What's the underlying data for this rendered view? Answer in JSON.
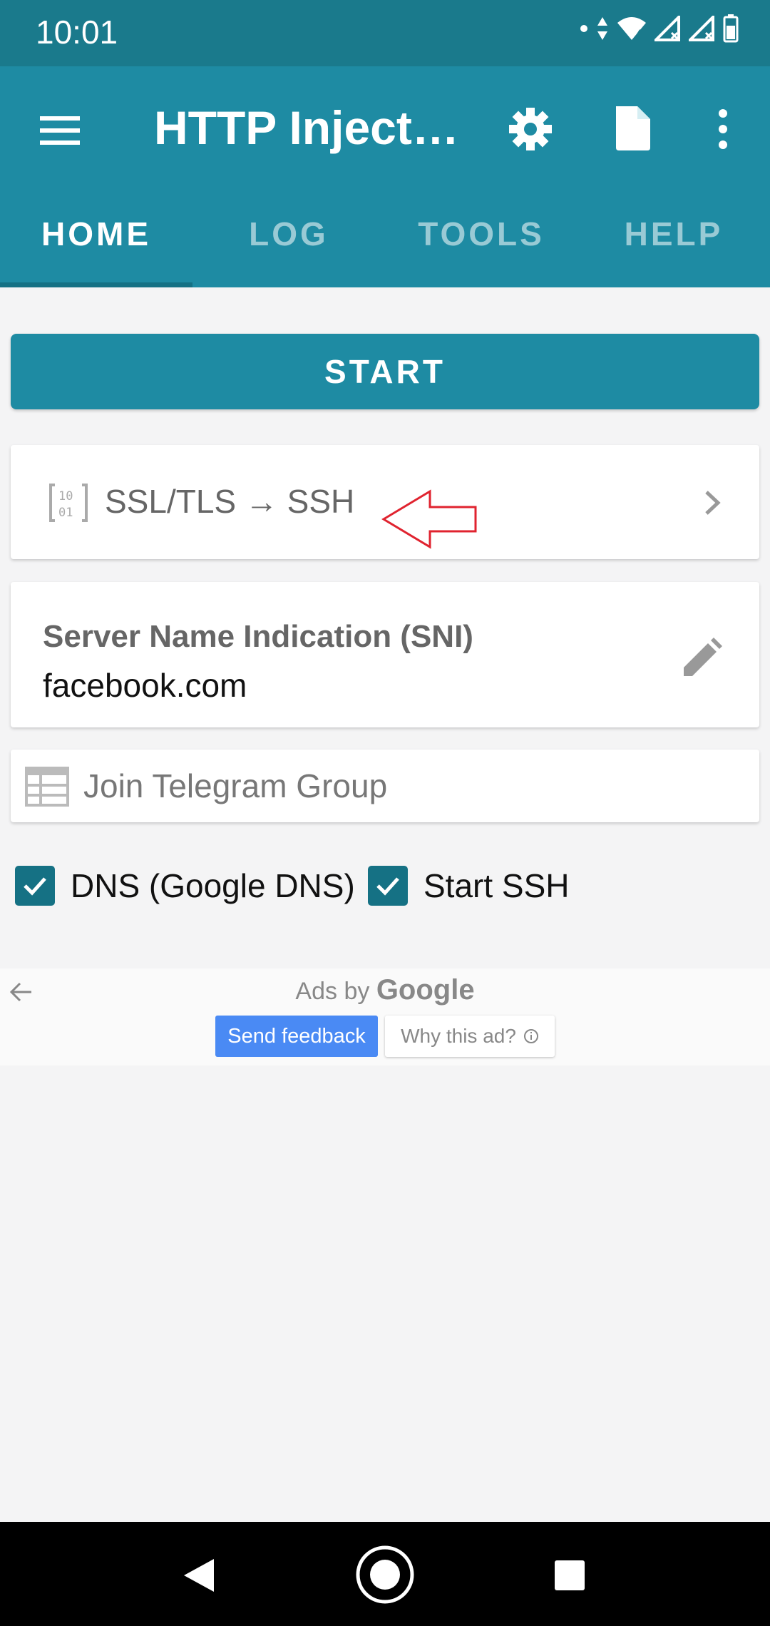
{
  "status_bar": {
    "time": "10:01",
    "icons": [
      "notification-dot-icon",
      "data-arrows-icon",
      "wifi-icon",
      "signal-icon",
      "signal-icon",
      "battery-icon"
    ]
  },
  "app_bar": {
    "title": "HTTP Inject…",
    "actions": [
      "menu-icon",
      "settings-icon",
      "file-icon",
      "more-vert-icon"
    ]
  },
  "tabs": [
    {
      "label": "HOME",
      "active": true
    },
    {
      "label": "LOG",
      "active": false
    },
    {
      "label": "TOOLS",
      "active": false
    },
    {
      "label": "HELP",
      "active": false
    }
  ],
  "main": {
    "start_label": "START",
    "mode_label": "SSL/TLS → SSH",
    "sni": {
      "title": "Server Name Indication (SNI)",
      "value": "facebook.com"
    },
    "telegram_label": "Join Telegram Group",
    "checkboxes": [
      {
        "label": "DNS (Google DNS)",
        "checked": true
      },
      {
        "label": "Start SSH",
        "checked": true
      }
    ]
  },
  "ads": {
    "ads_by": "Ads by",
    "google": "Google",
    "send_feedback": "Send feedback",
    "why_this_ad": "Why this ad?"
  },
  "colors": {
    "status_bar": "#1a7a8c",
    "app_bar": "#1e8ba3",
    "accent": "#157184",
    "annotation_arrow": "#e0232f"
  }
}
